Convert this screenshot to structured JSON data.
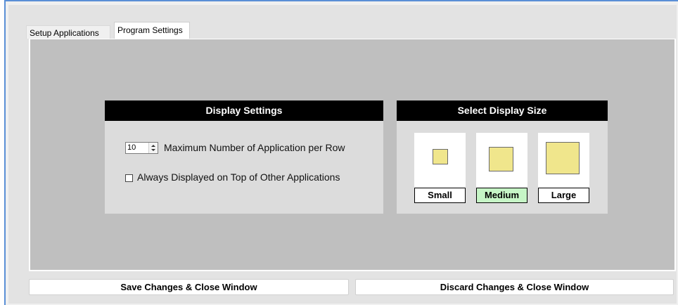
{
  "tabs": [
    {
      "label": "Setup Applications",
      "active": false
    },
    {
      "label": "Program Settings",
      "active": true
    }
  ],
  "display_settings": {
    "title": "Display Settings",
    "max_per_row_value": "10",
    "max_per_row_label": "Maximum Number of Application per Row",
    "always_on_top_label": "Always Displayed on Top of Other Applications",
    "always_on_top_checked": false
  },
  "display_size": {
    "title": "Select Display Size",
    "options": [
      {
        "label": "Small",
        "selected": false
      },
      {
        "label": "Medium",
        "selected": true
      },
      {
        "label": "Large",
        "selected": false
      }
    ],
    "swatch_color": "#f0e68c",
    "selected_color": "#c6f5c6"
  },
  "actions": {
    "save_label": "Save Changes & Close Window",
    "discard_label": "Discard Changes & Close Window"
  },
  "colors": {
    "window_border": "#5a8fd6",
    "tab_body": "#bfbfbf",
    "panel_header": "#000000"
  }
}
